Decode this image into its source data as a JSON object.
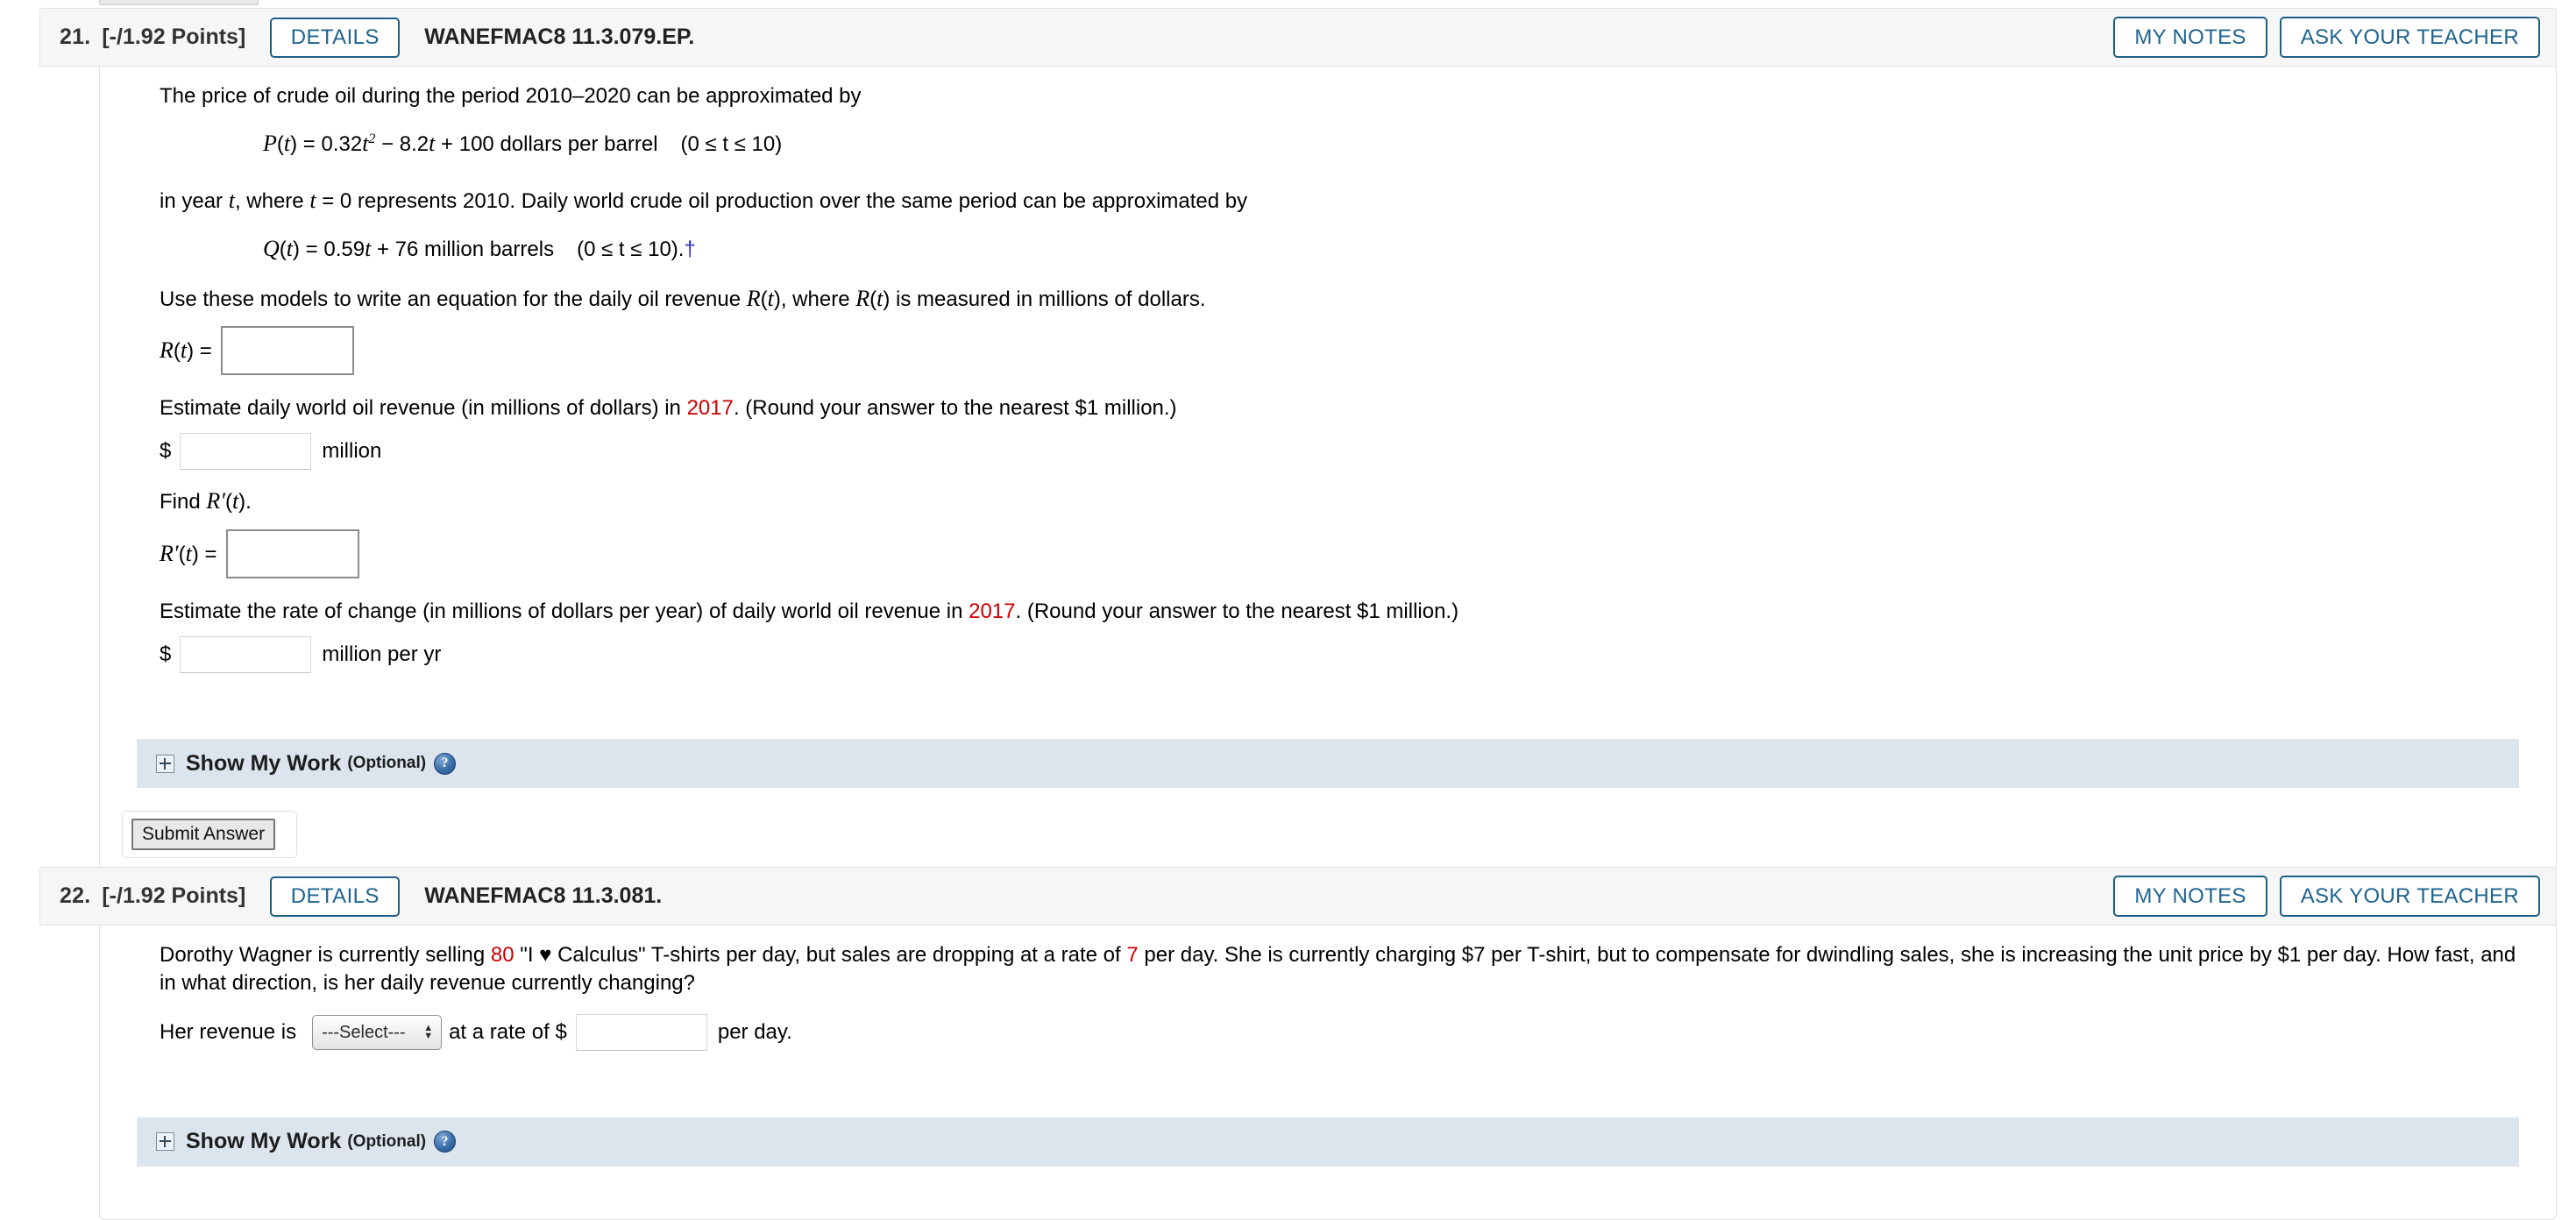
{
  "page": {
    "background": "#ffffff",
    "accent_blue": "#1f6490",
    "red": "#cc0000",
    "link_blue": "#2a2ac8",
    "smw_bar_color": "#dce5ee"
  },
  "questions": [
    {
      "number": "21.",
      "points": "[-/1.92 Points]",
      "details_label": "DETAILS",
      "code": "WANEFMAC8 11.3.079.EP.",
      "my_notes_label": "MY NOTES",
      "ask_teacher_label": "ASK YOUR TEACHER",
      "intro_line": "The price of crude oil during the period 2010–2020 can be approximated by",
      "formula_p": {
        "fn": "P",
        "var": "t",
        "body_a": " = 0.32",
        "exp": "2",
        "body_b": " − 8.2",
        "body_c": " + 100 dollars per barrel",
        "domain": "(0 ≤ t ≤ 10)"
      },
      "mid_line_a": "in year ",
      "mid_line_b": ", where ",
      "mid_line_c": " = 0 represents 2010. Daily world crude oil production over the same period can be approximated by",
      "formula_q": {
        "fn": "Q",
        "var": "t",
        "body_a": " = 0.59",
        "body_b": " + 76 million barrels",
        "domain": "(0 ≤ t ≤ 10).",
        "footnote_marker": "†"
      },
      "use_models_a": "Use these models to write an equation for the daily oil revenue ",
      "use_models_b": "(",
      "use_models_c": "), where ",
      "use_models_d": " is measured in millions of dollars.",
      "rt_label_fn": "R",
      "rt_label_var": "t",
      "rt_label_eq": " = ",
      "rt_value": "",
      "estimate_1_a": "Estimate daily world oil revenue (in millions of dollars) in ",
      "estimate_1_year": "2017",
      "estimate_1_b": ". (Round your answer to the nearest $1 million.)",
      "dollar_sign": "$",
      "estimate_1_value": "",
      "estimate_1_unit": "million",
      "find_label_a": "Find ",
      "find_label_fn": "R′",
      "find_label_var": "t",
      "find_label_b": ").",
      "rprime_label_fn": "R′",
      "rprime_label_var": "t",
      "rprime_label_eq": " = ",
      "rprime_value": "",
      "estimate_2_a": "Estimate the rate of change (in millions of dollars per year) of daily world oil revenue in ",
      "estimate_2_year": "2017",
      "estimate_2_b": ". (Round your answer to the nearest $1 million.)",
      "estimate_2_value": "",
      "estimate_2_unit": "million per yr",
      "show_my_work": "Show My Work",
      "show_my_work_optional": "(Optional)",
      "help_glyph": "?",
      "submit_label": "Submit Answer"
    },
    {
      "number": "22.",
      "points": "[-/1.92 Points]",
      "details_label": "DETAILS",
      "code": "WANEFMAC8 11.3.081.",
      "my_notes_label": "MY NOTES",
      "ask_teacher_label": "ASK YOUR TEACHER",
      "body_a": "Dorothy Wagner is currently selling ",
      "body_qty": "80",
      "body_b": " \"I ♥ Calculus\" T-shirts per day, but sales are dropping at a rate of ",
      "body_rate": "7",
      "body_c": " per day. She is currently charging $7 per T-shirt, but to compensate for dwindling sales, she is increasing the unit price by $1 per day. How fast, and in what direction, is her daily revenue currently changing?",
      "answer_a": "Her revenue is",
      "select_value": "---Select---",
      "select_options": [
        "---Select---"
      ],
      "answer_b": "at a rate of $",
      "answer_value": "",
      "answer_c": "per day.",
      "show_my_work": "Show My Work",
      "show_my_work_optional": "(Optional)",
      "help_glyph": "?"
    }
  ]
}
